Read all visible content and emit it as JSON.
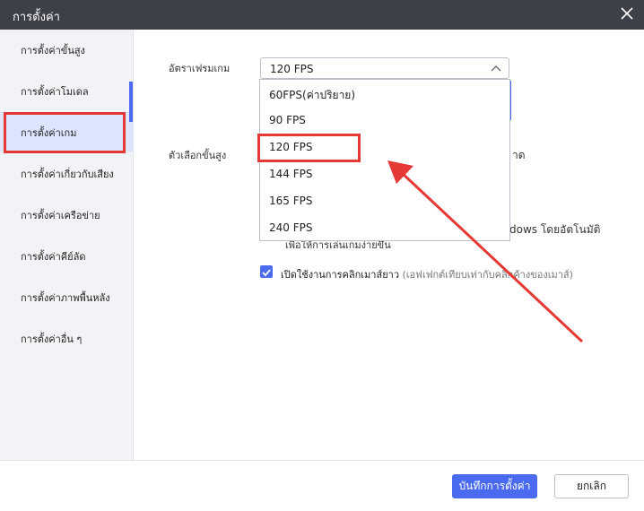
{
  "window": {
    "title": "การตั้งค่า"
  },
  "sidebar": {
    "items": [
      {
        "label": "การตั้งค่าขั้นสูง"
      },
      {
        "label": "การตั้งค่าโมเดล"
      },
      {
        "label": "การตั้งค่าเกม"
      },
      {
        "label": "การตั้งค่าเกี่ยวกับเสียง"
      },
      {
        "label": "การตั้งค่าเครือข่าย"
      },
      {
        "label": "การตั้งค่าคีย์ลัด"
      },
      {
        "label": "การตั้งค่าภาพพื้นหลัง"
      },
      {
        "label": "การตั้งค่าอื่น ๆ"
      }
    ],
    "active_index": 2
  },
  "main": {
    "frame_rate_label": "อัตราเฟรมเกม",
    "frame_rate_value": "120 FPS",
    "frame_rate_options": [
      "60FPS(ค่าปริยาย)",
      "90 FPS",
      "120 FPS",
      "144 FPS",
      "165 FPS",
      "240 FPS"
    ],
    "advanced_label": "ตัวเลือกขั้นสูง",
    "partial_text_1": "าด",
    "partial_text_2": "dows  โดยอัตโนมัติ",
    "partial_text_3": "เพื่อให้การเล่นเกมง่ายขึ้น",
    "mouse_option_label": "เปิดใช้งานการคลิกเมาส์ยาว",
    "mouse_option_note": "(เอฟเฟกต์เทียบเท่ากับคลิกค้างของเมาส์)",
    "mouse_option_checked": true
  },
  "footer": {
    "save_label": "บันทึกการตั้งค่า",
    "cancel_label": "ยกเลิก"
  },
  "colors": {
    "accent": "#4a6bef",
    "highlight": "#e53935",
    "titlebar": "#3d4048"
  },
  "icons": {
    "close": "close-icon",
    "chevron": "chevron-up-icon",
    "check": "check-icon"
  }
}
